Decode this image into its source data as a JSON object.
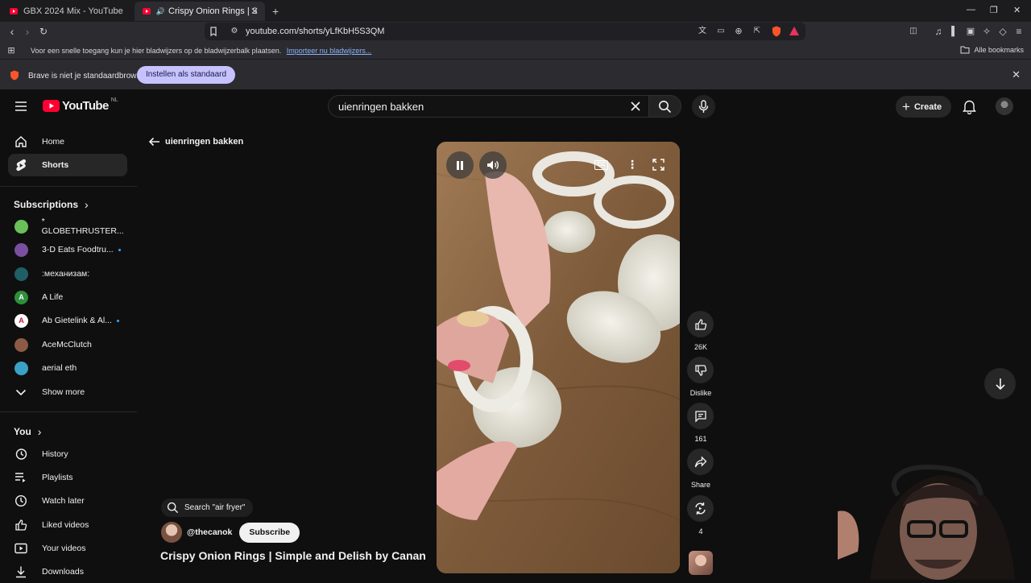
{
  "browser": {
    "tabs": [
      {
        "title": "GBX 2024 Mix - YouTube",
        "active": false
      },
      {
        "title": "Crispy Onion Rings | Simple a",
        "active": true
      }
    ],
    "url": "youtube.com/shorts/yLfKbH5S3QM",
    "bookmark_bar": {
      "message": "Voor een snelle toegang kun je hier bladwijzers op de bladwijzerbalk plaatsen.",
      "import_link": "Importeer nu bladwijzers...",
      "all_bookmarks": "Alle bookmarks"
    },
    "infobar": {
      "message": "Brave is niet je standaardbrowser",
      "button": "Instellen als standaard"
    }
  },
  "header": {
    "logo_text": "YouTube",
    "region": "NL",
    "search_value": "uienringen bakken",
    "create_label": "Create"
  },
  "sidebar": {
    "primary": [
      {
        "label": "Home",
        "icon": "home-icon",
        "active": false
      },
      {
        "label": "Shorts",
        "icon": "shorts-icon",
        "active": true
      }
    ],
    "subscriptions_title": "Subscriptions",
    "subscriptions": [
      {
        "label": "* GLOBETHRUSTER...",
        "color": "#6bbf59",
        "initial": "",
        "live": false
      },
      {
        "label": "3-D Eats Foodtru...",
        "color": "#7a4fa0",
        "initial": "",
        "live": true
      },
      {
        "label": ":механизам:",
        "color": "#1f5f66",
        "initial": "",
        "live": false
      },
      {
        "label": "A Life",
        "color": "#2f8f3a",
        "initial": "A",
        "live": false
      },
      {
        "label": "Ab Gietelink & Al...",
        "color": "#ffffff",
        "initial": "A",
        "live": true
      },
      {
        "label": "AceMcClutch",
        "color": "#8c5a45",
        "initial": "",
        "live": false
      },
      {
        "label": "aerial eth",
        "color": "#3aa0c8",
        "initial": "",
        "live": false
      }
    ],
    "show_more": "Show more",
    "you_title": "You",
    "you_items": [
      {
        "label": "History",
        "icon": "history-icon"
      },
      {
        "label": "Playlists",
        "icon": "playlists-icon"
      },
      {
        "label": "Watch later",
        "icon": "watch-later-icon"
      },
      {
        "label": "Liked videos",
        "icon": "like-icon"
      },
      {
        "label": "Your videos",
        "icon": "your-videos-icon"
      },
      {
        "label": "Downloads",
        "icon": "download-icon"
      }
    ]
  },
  "main": {
    "back_label": "uienringen bakken",
    "actions": {
      "likes": "26K",
      "dislike": "Dislike",
      "comments": "161",
      "share": "Share",
      "remix": "4"
    },
    "search_chip": "Search \"air fryer\"",
    "channel": "@thecanok",
    "subscribe": "Subscribe",
    "title": "Crispy Onion Rings | Simple and Delish by Canan"
  }
}
